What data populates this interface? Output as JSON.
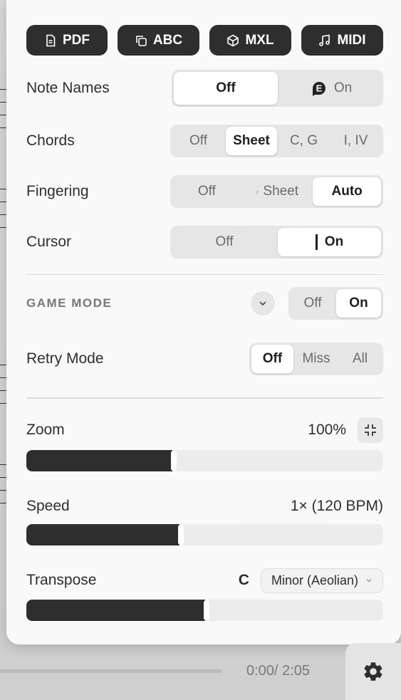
{
  "export": {
    "pdf": "PDF",
    "abc": "ABC",
    "mxl": "MXL",
    "midi": "MIDI"
  },
  "note_names": {
    "label": "Note Names",
    "options": [
      "Off",
      "On"
    ],
    "selected": "Off",
    "badge": "E"
  },
  "chords": {
    "label": "Chords",
    "options": [
      "Off",
      "Sheet",
      "C, G",
      "I, IV"
    ],
    "selected": "Sheet"
  },
  "fingering": {
    "label": "Fingering",
    "options": [
      "Off",
      "Sheet",
      "Auto"
    ],
    "selected": "Auto"
  },
  "cursor": {
    "label": "Cursor",
    "options": [
      "Off",
      "On"
    ],
    "selected": "On"
  },
  "game_mode": {
    "label": "GAME MODE",
    "options": [
      "Off",
      "On"
    ],
    "selected": "On"
  },
  "retry_mode": {
    "label": "Retry Mode",
    "options": [
      "Off",
      "Miss",
      "All"
    ],
    "selected": "Off"
  },
  "zoom": {
    "label": "Zoom",
    "value": "100%",
    "level": 0.41
  },
  "speed": {
    "label": "Speed",
    "value": "1× (120 BPM)",
    "level": 0.43
  },
  "transpose": {
    "label": "Transpose",
    "key": "C",
    "mode": "Minor (Aeolian)",
    "level": 0.5
  },
  "player": {
    "time": "0:00/ 2:05",
    "progress": 0
  },
  "colors": {
    "dark": "#2e2e2e",
    "panel": "#fafafa",
    "segment_bg": "#e6e6e6"
  }
}
